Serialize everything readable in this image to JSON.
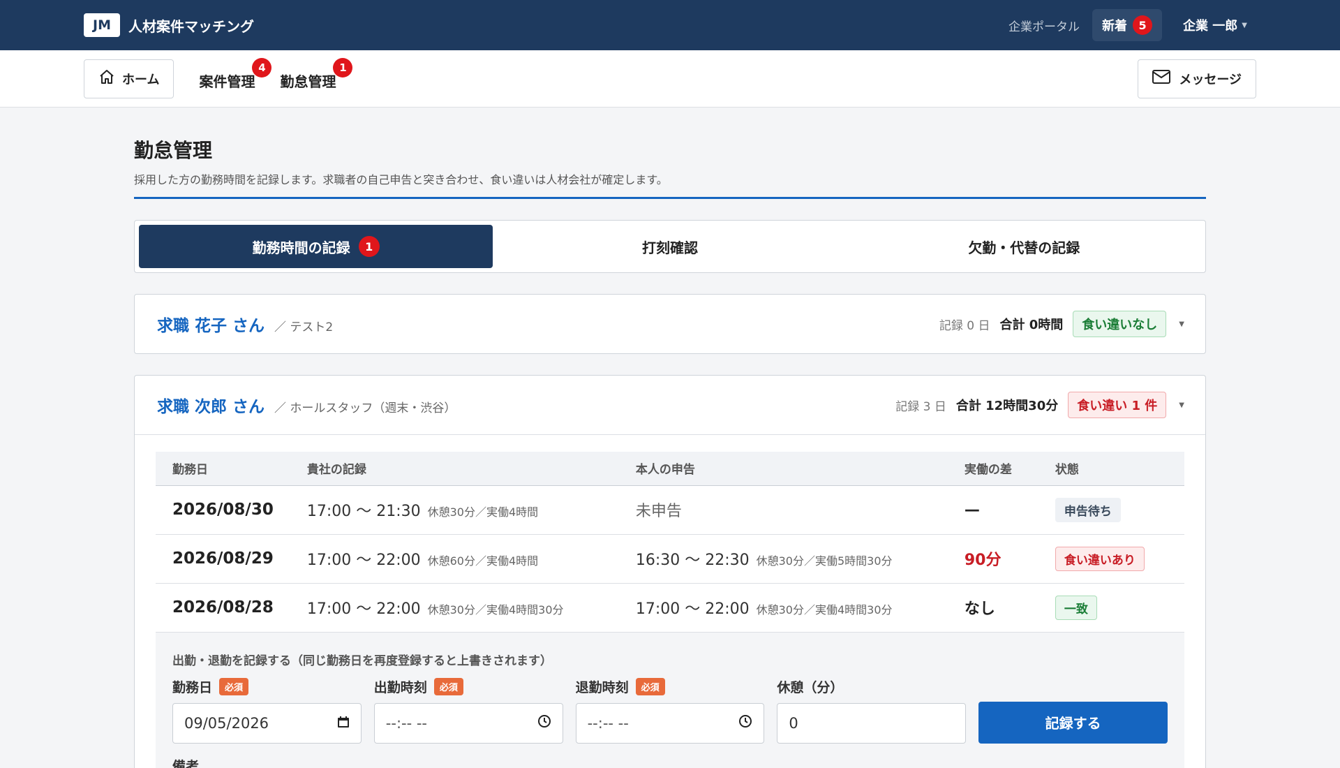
{
  "header": {
    "logo": "JM",
    "app_name": "人材案件マッチング",
    "portal_link": "企業ポータル",
    "new_label": "新着",
    "new_count": "5",
    "user_name": "企業 一郎"
  },
  "nav": {
    "home": "ホーム",
    "projects": "案件管理",
    "projects_count": "4",
    "attendance": "勤怠管理",
    "attendance_count": "1",
    "messages": "メッセージ"
  },
  "page": {
    "title": "勤怠管理",
    "description": "採用した方の勤務時間を記録します。求職者の自己申告と突き合わせ、食い違いは人材会社が確定します。"
  },
  "tabs": [
    {
      "label": "勤務時間の記録",
      "count": "1"
    },
    {
      "label": "打刻確認"
    },
    {
      "label": "欠勤・代替の記録"
    }
  ],
  "workers": [
    {
      "name": "求職 花子 さん",
      "role": "／ テスト2",
      "record_days": "記録 0 日",
      "total": "合計 0時間",
      "status": "食い違いなし"
    },
    {
      "name": "求職 次郎 さん",
      "role": "／ ホールスタッフ（週末・渋谷）",
      "record_days": "記録 3 日",
      "total": "合計 12時間30分",
      "status": "食い違い 1 件"
    }
  ],
  "table": {
    "headers": [
      "勤務日",
      "貴社の記録",
      "本人の申告",
      "実働の差",
      "状態"
    ],
    "rows": [
      {
        "date": "2026/08/30",
        "company_time": "17:00 〜 21:30",
        "company_note": "休憩30分／実働4時間",
        "self_time": "未申告",
        "self_note": "",
        "diff": "—",
        "status": "申告待ち"
      },
      {
        "date": "2026/08/29",
        "company_time": "17:00 〜 22:00",
        "company_note": "休憩60分／実働4時間",
        "self_time": "16:30 〜 22:30",
        "self_note": "休憩30分／実働5時間30分",
        "diff": "90分",
        "status": "食い違いあり"
      },
      {
        "date": "2026/08/28",
        "company_time": "17:00 〜 22:00",
        "company_note": "休憩30分／実働4時間30分",
        "self_time": "17:00 〜 22:00",
        "self_note": "休憩30分／実働4時間30分",
        "diff": "なし",
        "status": "一致"
      }
    ]
  },
  "form": {
    "caption": "出勤・退勤を記録する（同じ勤務日を再度登録すると上書きされます）",
    "required": "必須",
    "date_label": "勤務日",
    "date_value": "09/05/2026",
    "start_label": "出勤時刻",
    "start_placeholder": "--:-- --",
    "end_label": "退勤時刻",
    "end_placeholder": "--:-- --",
    "break_label": "休憩（分）",
    "break_value": "0",
    "submit": "記録する",
    "memo_label": "備考"
  }
}
